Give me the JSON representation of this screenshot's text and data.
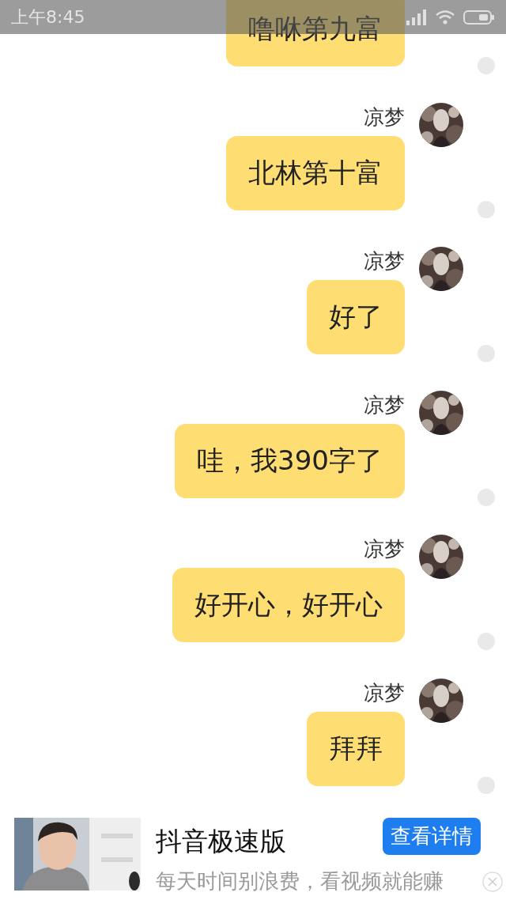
{
  "status_bar": {
    "time": "上午8:45"
  },
  "messages": [
    {
      "text": "噜咻第九富"
    },
    {
      "sender": "凉梦",
      "text": "北林第十富"
    },
    {
      "sender": "凉梦",
      "text": "好了"
    },
    {
      "sender": "凉梦",
      "text": "哇，我390字了"
    },
    {
      "sender": "凉梦",
      "text": "好开心，好开心"
    },
    {
      "sender": "凉梦",
      "text": "拜拜"
    }
  ],
  "ad": {
    "title": "抖音极速版",
    "button": "查看详情",
    "description": "每天时间别浪费，看视频就能赚"
  }
}
